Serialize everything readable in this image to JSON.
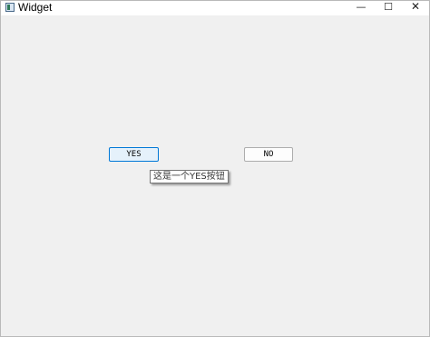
{
  "window": {
    "title": "Widget",
    "controls": {
      "minimize": "—",
      "maximize": "☐",
      "close": "✕"
    }
  },
  "buttons": {
    "yes_label": "YES",
    "no_label": "NO"
  },
  "tooltip": {
    "text": "这是一个YES按钮"
  },
  "icons": {
    "app": "app-window-icon"
  },
  "colors": {
    "background": "#f0f0f0",
    "focus_border": "#0078d7",
    "focus_fill": "#e5f1fb"
  }
}
